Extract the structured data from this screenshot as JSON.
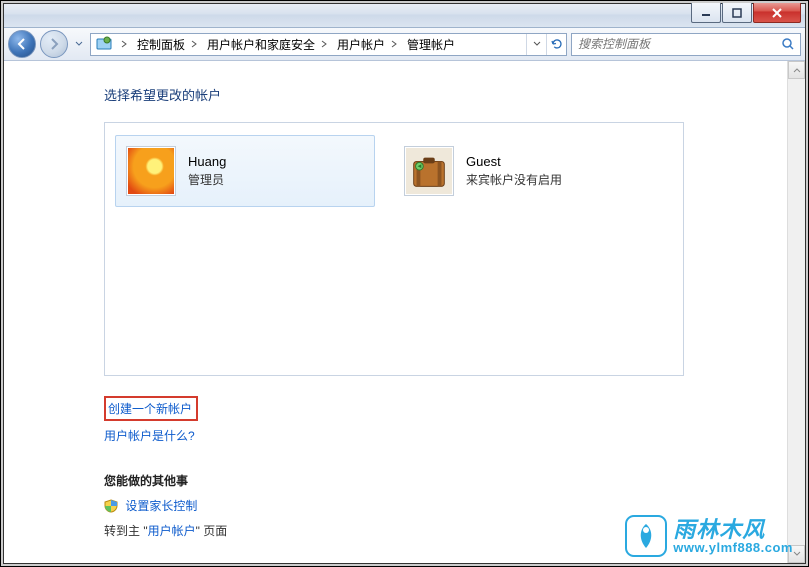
{
  "titlebar": {
    "min_icon": "minimize-icon",
    "max_icon": "maximize-icon",
    "close_icon": "close-icon"
  },
  "breadcrumb": {
    "items": [
      "控制面板",
      "用户帐户和家庭安全",
      "用户帐户",
      "管理帐户"
    ]
  },
  "search": {
    "placeholder": "搜索控制面板"
  },
  "page": {
    "heading": "选择希望更改的帐户"
  },
  "accounts": [
    {
      "name": "Huang",
      "sub": "管理员",
      "avatar_color1": "#f7a01c",
      "avatar_color2": "#e24a12",
      "selected": true
    },
    {
      "name": "Guest",
      "sub": "来宾帐户没有启用",
      "avatar_color1": "#b9722d",
      "avatar_color2": "#6b3e17",
      "selected": false
    }
  ],
  "links": {
    "create_account": "创建一个新帐户",
    "what_is": "用户帐户是什么?",
    "other_heading": "您能做的其他事",
    "parental": "设置家长控制",
    "goto_main_prefix": "转到主 \"",
    "goto_main_link": "用户帐户",
    "goto_main_suffix": "\" 页面"
  },
  "watermark": {
    "brand": "雨林木风",
    "url": "www.ylmf888.com"
  }
}
